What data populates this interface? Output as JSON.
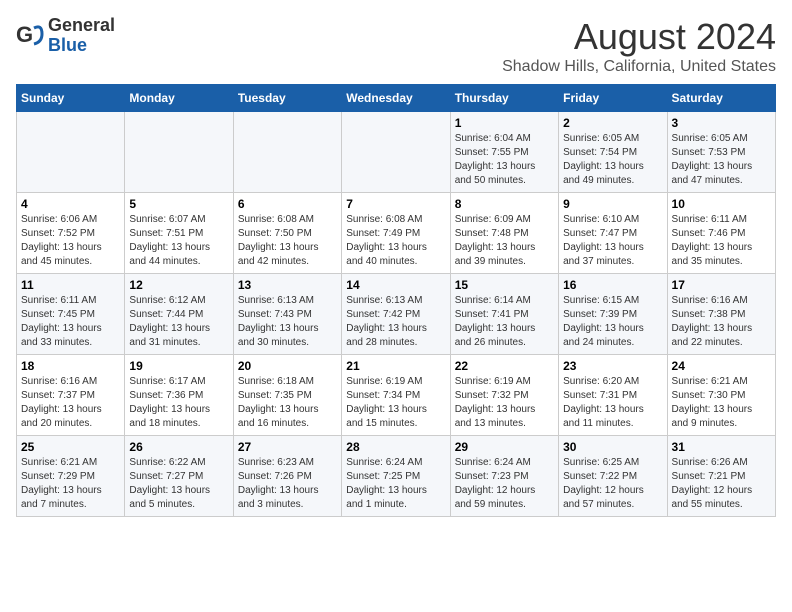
{
  "header": {
    "logo_general": "General",
    "logo_blue": "Blue",
    "main_title": "August 2024",
    "subtitle": "Shadow Hills, California, United States"
  },
  "days_of_week": [
    "Sunday",
    "Monday",
    "Tuesday",
    "Wednesday",
    "Thursday",
    "Friday",
    "Saturday"
  ],
  "weeks": [
    [
      {
        "day": "",
        "info": ""
      },
      {
        "day": "",
        "info": ""
      },
      {
        "day": "",
        "info": ""
      },
      {
        "day": "",
        "info": ""
      },
      {
        "day": "1",
        "info": "Sunrise: 6:04 AM\nSunset: 7:55 PM\nDaylight: 13 hours\nand 50 minutes."
      },
      {
        "day": "2",
        "info": "Sunrise: 6:05 AM\nSunset: 7:54 PM\nDaylight: 13 hours\nand 49 minutes."
      },
      {
        "day": "3",
        "info": "Sunrise: 6:05 AM\nSunset: 7:53 PM\nDaylight: 13 hours\nand 47 minutes."
      }
    ],
    [
      {
        "day": "4",
        "info": "Sunrise: 6:06 AM\nSunset: 7:52 PM\nDaylight: 13 hours\nand 45 minutes."
      },
      {
        "day": "5",
        "info": "Sunrise: 6:07 AM\nSunset: 7:51 PM\nDaylight: 13 hours\nand 44 minutes."
      },
      {
        "day": "6",
        "info": "Sunrise: 6:08 AM\nSunset: 7:50 PM\nDaylight: 13 hours\nand 42 minutes."
      },
      {
        "day": "7",
        "info": "Sunrise: 6:08 AM\nSunset: 7:49 PM\nDaylight: 13 hours\nand 40 minutes."
      },
      {
        "day": "8",
        "info": "Sunrise: 6:09 AM\nSunset: 7:48 PM\nDaylight: 13 hours\nand 39 minutes."
      },
      {
        "day": "9",
        "info": "Sunrise: 6:10 AM\nSunset: 7:47 PM\nDaylight: 13 hours\nand 37 minutes."
      },
      {
        "day": "10",
        "info": "Sunrise: 6:11 AM\nSunset: 7:46 PM\nDaylight: 13 hours\nand 35 minutes."
      }
    ],
    [
      {
        "day": "11",
        "info": "Sunrise: 6:11 AM\nSunset: 7:45 PM\nDaylight: 13 hours\nand 33 minutes."
      },
      {
        "day": "12",
        "info": "Sunrise: 6:12 AM\nSunset: 7:44 PM\nDaylight: 13 hours\nand 31 minutes."
      },
      {
        "day": "13",
        "info": "Sunrise: 6:13 AM\nSunset: 7:43 PM\nDaylight: 13 hours\nand 30 minutes."
      },
      {
        "day": "14",
        "info": "Sunrise: 6:13 AM\nSunset: 7:42 PM\nDaylight: 13 hours\nand 28 minutes."
      },
      {
        "day": "15",
        "info": "Sunrise: 6:14 AM\nSunset: 7:41 PM\nDaylight: 13 hours\nand 26 minutes."
      },
      {
        "day": "16",
        "info": "Sunrise: 6:15 AM\nSunset: 7:39 PM\nDaylight: 13 hours\nand 24 minutes."
      },
      {
        "day": "17",
        "info": "Sunrise: 6:16 AM\nSunset: 7:38 PM\nDaylight: 13 hours\nand 22 minutes."
      }
    ],
    [
      {
        "day": "18",
        "info": "Sunrise: 6:16 AM\nSunset: 7:37 PM\nDaylight: 13 hours\nand 20 minutes."
      },
      {
        "day": "19",
        "info": "Sunrise: 6:17 AM\nSunset: 7:36 PM\nDaylight: 13 hours\nand 18 minutes."
      },
      {
        "day": "20",
        "info": "Sunrise: 6:18 AM\nSunset: 7:35 PM\nDaylight: 13 hours\nand 16 minutes."
      },
      {
        "day": "21",
        "info": "Sunrise: 6:19 AM\nSunset: 7:34 PM\nDaylight: 13 hours\nand 15 minutes."
      },
      {
        "day": "22",
        "info": "Sunrise: 6:19 AM\nSunset: 7:32 PM\nDaylight: 13 hours\nand 13 minutes."
      },
      {
        "day": "23",
        "info": "Sunrise: 6:20 AM\nSunset: 7:31 PM\nDaylight: 13 hours\nand 11 minutes."
      },
      {
        "day": "24",
        "info": "Sunrise: 6:21 AM\nSunset: 7:30 PM\nDaylight: 13 hours\nand 9 minutes."
      }
    ],
    [
      {
        "day": "25",
        "info": "Sunrise: 6:21 AM\nSunset: 7:29 PM\nDaylight: 13 hours\nand 7 minutes."
      },
      {
        "day": "26",
        "info": "Sunrise: 6:22 AM\nSunset: 7:27 PM\nDaylight: 13 hours\nand 5 minutes."
      },
      {
        "day": "27",
        "info": "Sunrise: 6:23 AM\nSunset: 7:26 PM\nDaylight: 13 hours\nand 3 minutes."
      },
      {
        "day": "28",
        "info": "Sunrise: 6:24 AM\nSunset: 7:25 PM\nDaylight: 13 hours\nand 1 minute."
      },
      {
        "day": "29",
        "info": "Sunrise: 6:24 AM\nSunset: 7:23 PM\nDaylight: 12 hours\nand 59 minutes."
      },
      {
        "day": "30",
        "info": "Sunrise: 6:25 AM\nSunset: 7:22 PM\nDaylight: 12 hours\nand 57 minutes."
      },
      {
        "day": "31",
        "info": "Sunrise: 6:26 AM\nSunset: 7:21 PM\nDaylight: 12 hours\nand 55 minutes."
      }
    ]
  ]
}
